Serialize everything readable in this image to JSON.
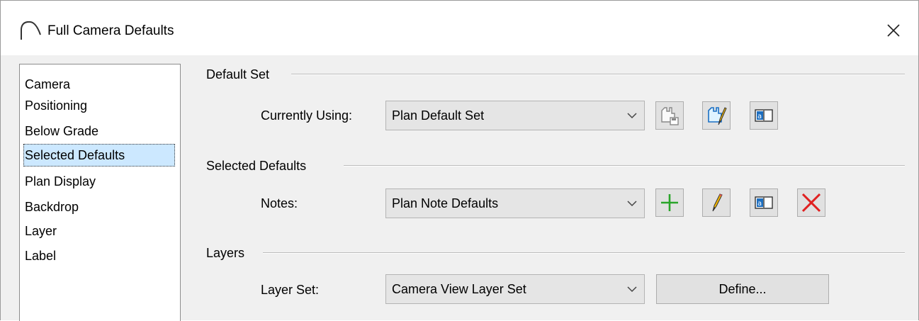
{
  "window": {
    "title": "Full Camera Defaults",
    "close_glyph": "✕"
  },
  "sidebar": {
    "items": [
      {
        "label": "Camera",
        "selected": false
      },
      {
        "label": "Positioning",
        "selected": false
      },
      {
        "label": "Below Grade",
        "selected": false
      },
      {
        "label": "Selected Defaults",
        "selected": true
      },
      {
        "label": "Plan Display",
        "selected": false
      },
      {
        "label": "Backdrop",
        "selected": false
      },
      {
        "label": "Layer",
        "selected": false
      },
      {
        "label": "Label",
        "selected": false
      }
    ]
  },
  "default_set": {
    "group_label": "Default Set",
    "field_label": "Currently Using:",
    "value": "Plan Default Set",
    "buttons": [
      "save-default-set-icon",
      "edit-default-set-icon",
      "rename-default-set-icon"
    ]
  },
  "selected_defaults": {
    "group_label": "Selected Defaults",
    "field_label": "Notes:",
    "value": "Plan Note Defaults",
    "buttons": [
      "add-icon",
      "edit-pencil-icon",
      "rename-icon",
      "delete-icon"
    ]
  },
  "layers": {
    "group_label": "Layers",
    "field_label": "Layer Set:",
    "value": "Camera View Layer Set",
    "define_label": "Define..."
  },
  "colors": {
    "selection": "#cce8ff",
    "add_green": "#2aa52a",
    "delete_red": "#e02020",
    "pencil_yellow": "#f2b705"
  }
}
